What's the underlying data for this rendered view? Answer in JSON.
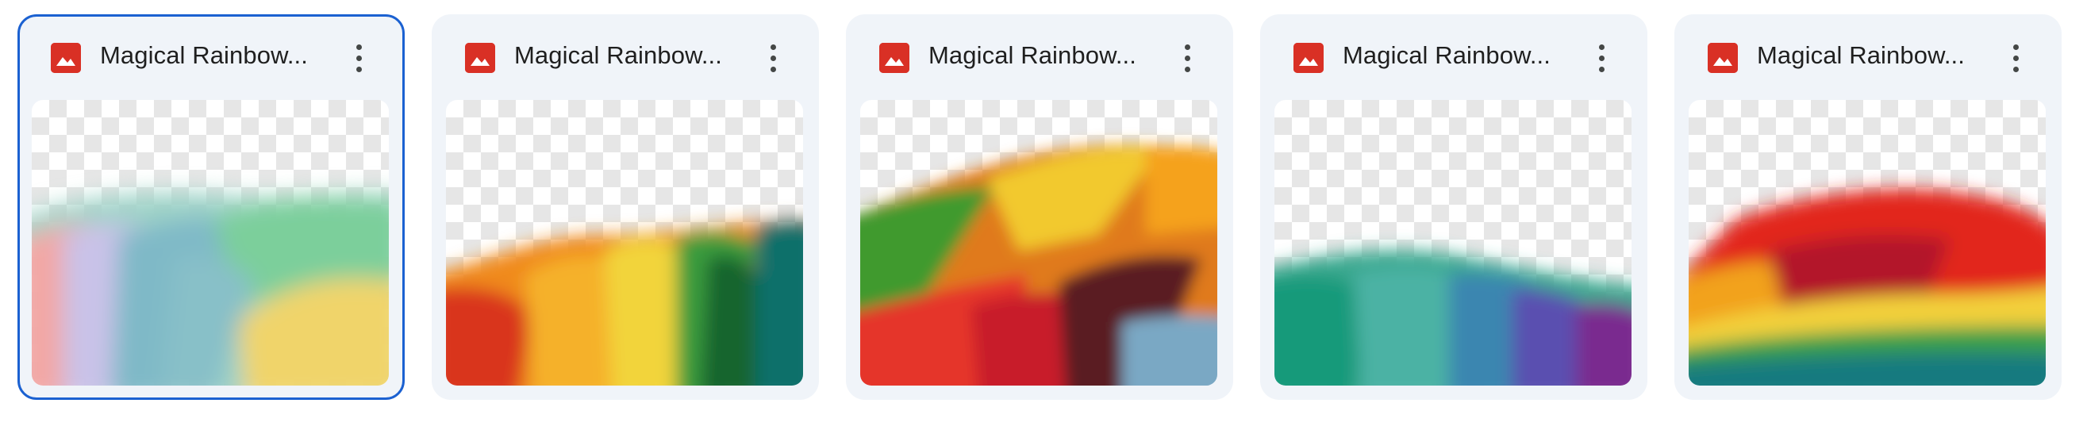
{
  "files": [
    {
      "name": "Magical Rainbow...",
      "icon": "image-file-icon",
      "selected": true
    },
    {
      "name": "Magical Rainbow...",
      "icon": "image-file-icon",
      "selected": false
    },
    {
      "name": "Magical Rainbow...",
      "icon": "image-file-icon",
      "selected": false
    },
    {
      "name": "Magical Rainbow...",
      "icon": "image-file-icon",
      "selected": false
    },
    {
      "name": "Magical Rainbow...",
      "icon": "image-file-icon",
      "selected": false
    }
  ],
  "colors": {
    "card_background": "#f0f4f9",
    "selected_border": "#1b61d1",
    "file_icon": "#d93025",
    "text": "#1f1f1f"
  }
}
